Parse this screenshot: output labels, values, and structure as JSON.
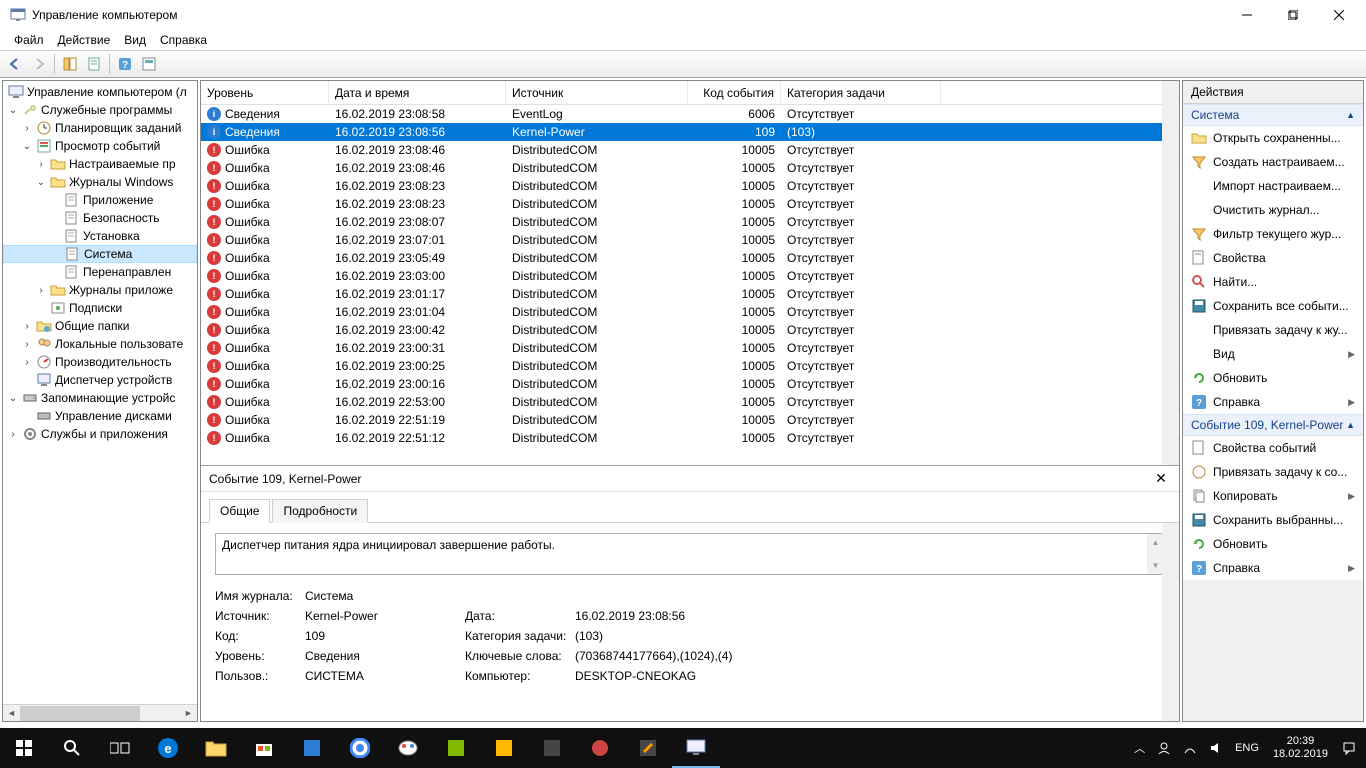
{
  "window": {
    "title": "Управление компьютером"
  },
  "menu": {
    "file": "Файл",
    "action": "Действие",
    "view": "Вид",
    "help": "Справка"
  },
  "tree": {
    "root": "Управление компьютером (л",
    "svc": "Служебные программы",
    "sched": "Планировщик заданий",
    "evtviewer": "Просмотр событий",
    "custom": "Настраиваемые пр",
    "winlogs": "Журналы Windows",
    "app": "Приложение",
    "sec": "Безопасность",
    "setup": "Установка",
    "system": "Система",
    "fwd": "Перенаправлен",
    "applogs": "Журналы приложе",
    "subs": "Подписки",
    "shared": "Общие папки",
    "users": "Локальные пользовате",
    "perf": "Производительность",
    "devmgr": "Диспетчер устройств",
    "storage": "Запоминающие устройс",
    "diskmgr": "Управление дисками",
    "svcapps": "Службы и приложения"
  },
  "cols": {
    "level": "Уровень",
    "date": "Дата и время",
    "src": "Источник",
    "id": "Код события",
    "cat": "Категория задачи"
  },
  "events": [
    {
      "t": "info",
      "lvl": "Сведения",
      "dt": "16.02.2019 23:08:58",
      "src": "EventLog",
      "id": "6006",
      "cat": "Отсутствует"
    },
    {
      "t": "info",
      "lvl": "Сведения",
      "dt": "16.02.2019 23:08:56",
      "src": "Kernel-Power",
      "id": "109",
      "cat": "(103)",
      "sel": true
    },
    {
      "t": "err",
      "lvl": "Ошибка",
      "dt": "16.02.2019 23:08:46",
      "src": "DistributedCOM",
      "id": "10005",
      "cat": "Отсутствует"
    },
    {
      "t": "err",
      "lvl": "Ошибка",
      "dt": "16.02.2019 23:08:46",
      "src": "DistributedCOM",
      "id": "10005",
      "cat": "Отсутствует"
    },
    {
      "t": "err",
      "lvl": "Ошибка",
      "dt": "16.02.2019 23:08:23",
      "src": "DistributedCOM",
      "id": "10005",
      "cat": "Отсутствует"
    },
    {
      "t": "err",
      "lvl": "Ошибка",
      "dt": "16.02.2019 23:08:23",
      "src": "DistributedCOM",
      "id": "10005",
      "cat": "Отсутствует"
    },
    {
      "t": "err",
      "lvl": "Ошибка",
      "dt": "16.02.2019 23:08:07",
      "src": "DistributedCOM",
      "id": "10005",
      "cat": "Отсутствует"
    },
    {
      "t": "err",
      "lvl": "Ошибка",
      "dt": "16.02.2019 23:07:01",
      "src": "DistributedCOM",
      "id": "10005",
      "cat": "Отсутствует"
    },
    {
      "t": "err",
      "lvl": "Ошибка",
      "dt": "16.02.2019 23:05:49",
      "src": "DistributedCOM",
      "id": "10005",
      "cat": "Отсутствует"
    },
    {
      "t": "err",
      "lvl": "Ошибка",
      "dt": "16.02.2019 23:03:00",
      "src": "DistributedCOM",
      "id": "10005",
      "cat": "Отсутствует"
    },
    {
      "t": "err",
      "lvl": "Ошибка",
      "dt": "16.02.2019 23:01:17",
      "src": "DistributedCOM",
      "id": "10005",
      "cat": "Отсутствует"
    },
    {
      "t": "err",
      "lvl": "Ошибка",
      "dt": "16.02.2019 23:01:04",
      "src": "DistributedCOM",
      "id": "10005",
      "cat": "Отсутствует"
    },
    {
      "t": "err",
      "lvl": "Ошибка",
      "dt": "16.02.2019 23:00:42",
      "src": "DistributedCOM",
      "id": "10005",
      "cat": "Отсутствует"
    },
    {
      "t": "err",
      "lvl": "Ошибка",
      "dt": "16.02.2019 23:00:31",
      "src": "DistributedCOM",
      "id": "10005",
      "cat": "Отсутствует"
    },
    {
      "t": "err",
      "lvl": "Ошибка",
      "dt": "16.02.2019 23:00:25",
      "src": "DistributedCOM",
      "id": "10005",
      "cat": "Отсутствует"
    },
    {
      "t": "err",
      "lvl": "Ошибка",
      "dt": "16.02.2019 23:00:16",
      "src": "DistributedCOM",
      "id": "10005",
      "cat": "Отсутствует"
    },
    {
      "t": "err",
      "lvl": "Ошибка",
      "dt": "16.02.2019 22:53:00",
      "src": "DistributedCOM",
      "id": "10005",
      "cat": "Отсутствует"
    },
    {
      "t": "err",
      "lvl": "Ошибка",
      "dt": "16.02.2019 22:51:19",
      "src": "DistributedCOM",
      "id": "10005",
      "cat": "Отсутствует"
    },
    {
      "t": "err",
      "lvl": "Ошибка",
      "dt": "16.02.2019 22:51:12",
      "src": "DistributedCOM",
      "id": "10005",
      "cat": "Отсутствует"
    }
  ],
  "detail": {
    "title": "Событие 109, Kernel-Power",
    "tab_general": "Общие",
    "tab_details": "Подробности",
    "message": "Диспетчер питания ядра инициировал завершение работы.",
    "k_log": "Имя журнала:",
    "v_log": "Система",
    "k_src": "Источник:",
    "v_src": "Kernel-Power",
    "k_date": "Дата:",
    "v_date": "16.02.2019 23:08:56",
    "k_id": "Код:",
    "v_id": "109",
    "k_cat": "Категория задачи:",
    "v_cat": "(103)",
    "k_lvl": "Уровень:",
    "v_lvl": "Сведения",
    "k_kw": "Ключевые слова:",
    "v_kw": "(70368744177664),(1024),(4)",
    "k_user": "Пользов.:",
    "v_user": "СИСТЕМА",
    "k_comp": "Компьютер:",
    "v_comp": "DESKTOP-CNEOKAG"
  },
  "actions": {
    "header": "Действия",
    "sec1": "Система",
    "open_saved": "Открыть сохраненны...",
    "create_custom": "Создать настраиваем...",
    "import_custom": "Импорт настраиваем...",
    "clear_log": "Очистить журнал...",
    "filter": "Фильтр текущего жур...",
    "props": "Свойства",
    "find": "Найти...",
    "save_all": "Сохранить все событи...",
    "attach": "Привязать задачу к жу...",
    "view": "Вид",
    "refresh": "Обновить",
    "help": "Справка",
    "sec2": "Событие 109, Kernel-Power",
    "evt_props": "Свойства событий",
    "evt_attach": "Привязать задачу к со...",
    "copy": "Копировать",
    "save_sel": "Сохранить выбранны...",
    "refresh2": "Обновить",
    "help2": "Справка"
  },
  "tray": {
    "lang": "ENG",
    "time": "20:39",
    "date": "18.02.2019"
  }
}
